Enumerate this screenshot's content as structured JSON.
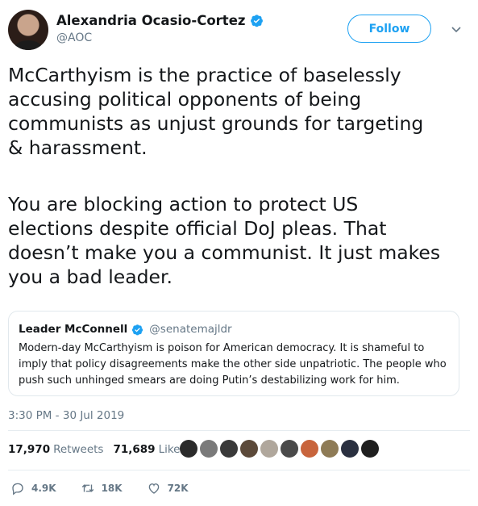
{
  "author": {
    "name": "Alexandria Ocasio-Cortez",
    "handle": "@AOC"
  },
  "follow_label": "Follow",
  "tweet": {
    "paragraph1": "McCarthyism is the practice of baselessly\naccusing political opponents of being\ncommunists as unjust grounds for targeting\n& harassment.",
    "paragraph2": "You are blocking action to protect US\nelections despite official DoJ pleas. That\ndoesn’t make you a communist. It just makes\nyou a bad leader."
  },
  "quote": {
    "name": "Leader McConnell",
    "handle": "@senatemajldr",
    "text": "Modern-day McCarthyism is poison for American democracy. It is shameful to imply that policy disagreements make the other side unpatriotic. The people who push such unhinged smears are doing Putin’s destabilizing work for him."
  },
  "timestamp": "3:30 PM - 30 Jul 2019",
  "stats": {
    "retweets_count": "17,970",
    "retweets_label": "Retweets",
    "likes_count": "71,689",
    "likes_label": "Likes"
  },
  "liker_colors": [
    "#2b2b2b",
    "#7a7a7a",
    "#3a3a3a",
    "#5c4a3a",
    "#b0a79c",
    "#4a4a4a",
    "#c8643c",
    "#8e7b56",
    "#2a3040",
    "#1f1f1f"
  ],
  "actions": {
    "replies": "4.9K",
    "retweets": "18K",
    "likes": "72K"
  },
  "colors": {
    "accent": "#1da1f2",
    "muted": "#657786",
    "text": "#14171a"
  }
}
